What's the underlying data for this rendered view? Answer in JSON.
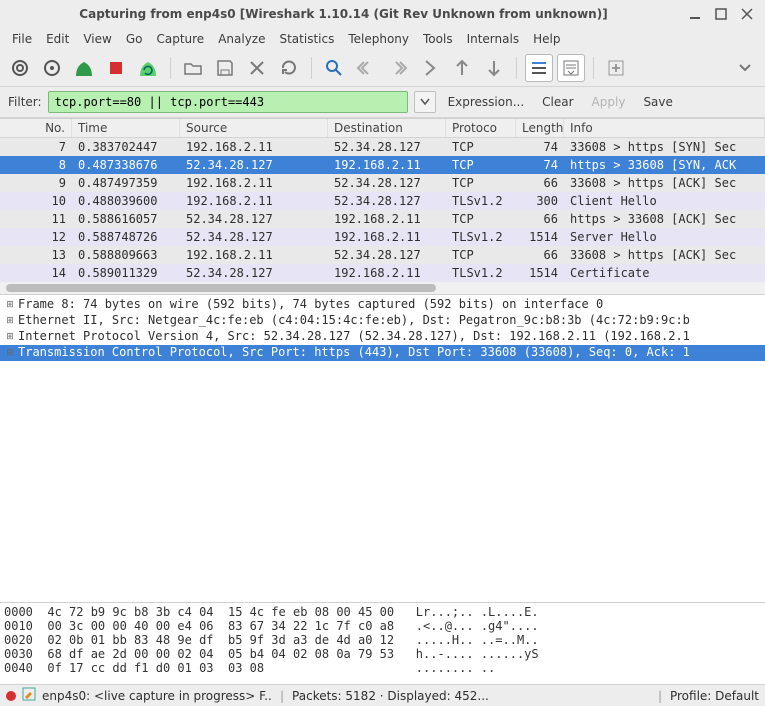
{
  "window": {
    "title": "Capturing from enp4s0    [Wireshark 1.10.14  (Git Rev Unknown from unknown)]"
  },
  "menu": {
    "items": [
      "File",
      "Edit",
      "View",
      "Go",
      "Capture",
      "Analyze",
      "Statistics",
      "Telephony",
      "Tools",
      "Internals",
      "Help"
    ]
  },
  "filter": {
    "label": "Filter:",
    "value": "tcp.port==80 || tcp.port==443",
    "expression": "Expression...",
    "clear": "Clear",
    "apply": "Apply",
    "save": "Save"
  },
  "columns": {
    "no": "No.",
    "time": "Time",
    "src": "Source",
    "dst": "Destination",
    "proto": "Protoco",
    "len": "Length",
    "info": "Info"
  },
  "packets": [
    {
      "no": "7",
      "time": "0.383702447",
      "src": "192.168.2.11",
      "dst": "52.34.28.127",
      "proto": "TCP",
      "len": "74",
      "info": "33608 > https [SYN] Sec",
      "cls": "tcp"
    },
    {
      "no": "8",
      "time": "0.487338676",
      "src": "52.34.28.127",
      "dst": "192.168.2.11",
      "proto": "TCP",
      "len": "74",
      "info": "https > 33608 [SYN, ACK",
      "cls": "sel"
    },
    {
      "no": "9",
      "time": "0.487497359",
      "src": "192.168.2.11",
      "dst": "52.34.28.127",
      "proto": "TCP",
      "len": "66",
      "info": "33608 > https [ACK] Sec",
      "cls": "tcp"
    },
    {
      "no": "10",
      "time": "0.488039600",
      "src": "192.168.2.11",
      "dst": "52.34.28.127",
      "proto": "TLSv1.2",
      "len": "300",
      "info": "Client Hello",
      "cls": "tls"
    },
    {
      "no": "11",
      "time": "0.588616057",
      "src": "52.34.28.127",
      "dst": "192.168.2.11",
      "proto": "TCP",
      "len": "66",
      "info": "https > 33608 [ACK] Sec",
      "cls": "tcp"
    },
    {
      "no": "12",
      "time": "0.588748726",
      "src": "52.34.28.127",
      "dst": "192.168.2.11",
      "proto": "TLSv1.2",
      "len": "1514",
      "info": "Server Hello",
      "cls": "tls"
    },
    {
      "no": "13",
      "time": "0.588809663",
      "src": "192.168.2.11",
      "dst": "52.34.28.127",
      "proto": "TCP",
      "len": "66",
      "info": "33608 > https [ACK] Sec",
      "cls": "tcp"
    },
    {
      "no": "14",
      "time": "0.589011329",
      "src": "52.34.28.127",
      "dst": "192.168.2.11",
      "proto": "TLSv1.2",
      "len": "1514",
      "info": "Certificate",
      "cls": "tls"
    }
  ],
  "details": [
    {
      "text": "Frame 8: 74 bytes on wire (592 bits), 74 bytes captured (592 bits) on interface 0",
      "sel": false
    },
    {
      "text": "Ethernet II, Src: Netgear_4c:fe:eb (c4:04:15:4c:fe:eb), Dst: Pegatron_9c:b8:3b (4c:72:b9:9c:b",
      "sel": false
    },
    {
      "text": "Internet Protocol Version 4, Src: 52.34.28.127 (52.34.28.127), Dst: 192.168.2.11 (192.168.2.1",
      "sel": false
    },
    {
      "text": "Transmission Control Protocol, Src Port: https (443), Dst Port: 33608 (33608), Seq: 0, Ack: 1",
      "sel": true
    }
  ],
  "hex": [
    "0000  4c 72 b9 9c b8 3b c4 04  15 4c fe eb 08 00 45 00   Lr...;.. .L....E.",
    "0010  00 3c 00 00 40 00 e4 06  83 67 34 22 1c 7f c0 a8   .<..@... .g4\"....",
    "0020  02 0b 01 bb 83 48 9e df  b5 9f 3d a3 de 4d a0 12   .....H.. ..=..M..",
    "0030  68 df ae 2d 00 00 02 04  05 b4 04 02 08 0a 79 53   h..-.... ......yS",
    "0040  0f 17 cc dd f1 d0 01 03  03 08                     ........ .."
  ],
  "status": {
    "capture": "enp4s0: <live capture in progress> F...",
    "packets": "Packets: 5182 · Displayed: 452...",
    "profile": "Profile: Default"
  },
  "colors": {
    "capture_dot": "#d62f2f",
    "edit_icon": "#e08a1f"
  }
}
